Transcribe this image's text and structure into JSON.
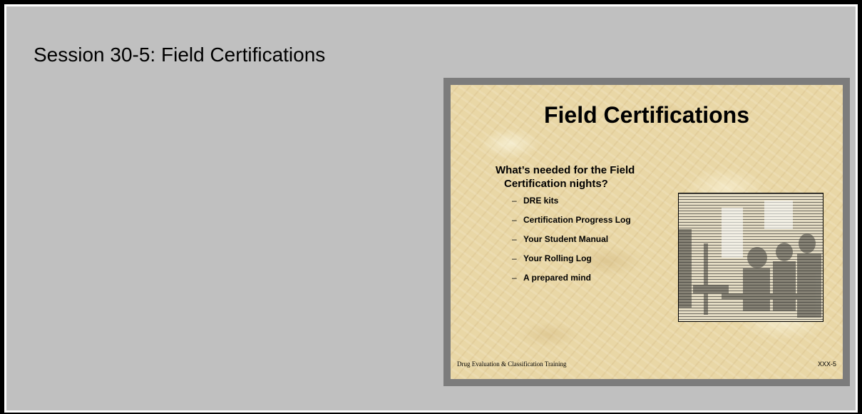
{
  "session_title": "Session 30-5: Field Certifications",
  "slide": {
    "title": "Field Certifications",
    "question_lines": [
      "What’s needed for the Field",
      "Certification nights?"
    ],
    "bullets": [
      "DRE kits",
      "Certification Progress Log",
      "Your Student Manual",
      "Your Rolling Log",
      "A prepared mind"
    ],
    "bullet_marker": "–",
    "footer_left": "Drug Evaluation & Classification Training",
    "footer_right": "XXX-5"
  },
  "colors": {
    "outer_border": "#000000",
    "panel_background": "#c0c0c0",
    "slide_frame": "#7c7c7c",
    "slide_background": "#e9d7a6"
  },
  "icons": {
    "photo": "classroom-photo"
  }
}
